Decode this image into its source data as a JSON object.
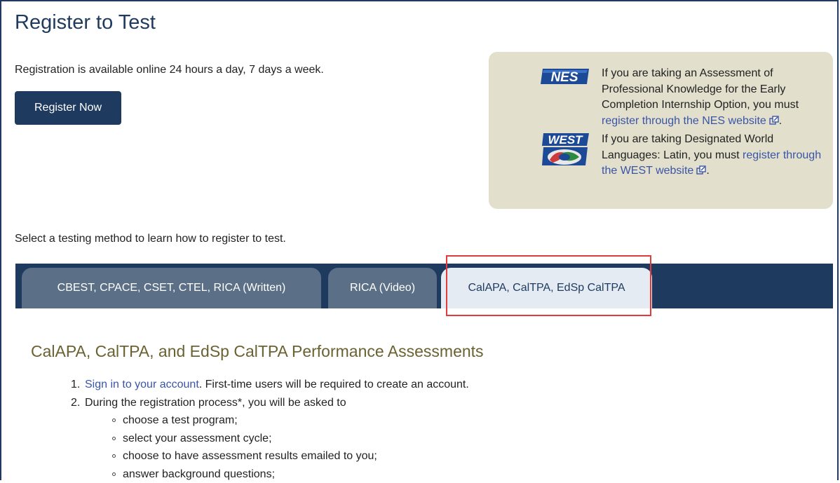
{
  "page": {
    "title": "Register to Test"
  },
  "intro": {
    "text": "Registration is available online 24 hours a day, 7 days a week.",
    "button_label": "Register Now"
  },
  "info_box": {
    "nes": {
      "logo_text": "NES",
      "text_before": "If you are taking an Assessment of Professional Knowledge for the Early Completion Internship Option, you must",
      "link": "register through the NES website",
      "text_after": "."
    },
    "west": {
      "logo_text": "WEST",
      "text_before": "If you are taking Designated World Languages: Latin, you must",
      "link": "register through the WEST website",
      "text_after": "."
    }
  },
  "select_text": "Select a testing method to learn how to register to test.",
  "tabs": [
    {
      "label": "CBEST, CPACE, CSET, CTEL, RICA (Written)",
      "active": false
    },
    {
      "label": "RICA (Video)",
      "active": false
    },
    {
      "label": "CalAPA, CalTPA, EdSp CalTPA",
      "active": true
    }
  ],
  "section": {
    "title": "CalAPA, CalTPA, and EdSp CalTPA Performance Assessments",
    "steps": [
      {
        "num": "1.",
        "link": "Sign in to your account",
        "text": ". First-time users will be required to create an account."
      },
      {
        "num": "2.",
        "text": "During the registration process*, you will be asked to",
        "substeps": [
          "choose a test program;",
          "select your assessment cycle;",
          "choose to have assessment results emailed to you;",
          "answer background questions;"
        ]
      }
    ]
  },
  "colors": {
    "primary_navy": "#1f3a5f",
    "info_box_bg": "#e2dfcc",
    "link_blue": "#3a55a8",
    "section_title_olive": "#6b6232",
    "highlight_red": "#e33b3b",
    "inactive_tab": "#5b6f86",
    "active_tab": "#e4ebf3"
  }
}
